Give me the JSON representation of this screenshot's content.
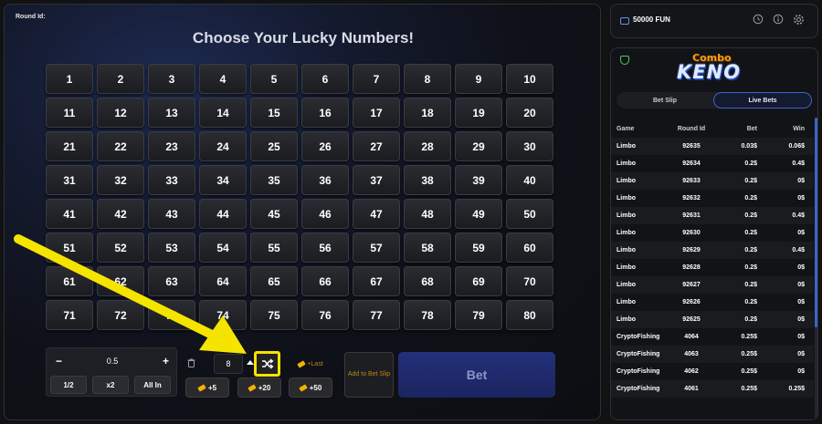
{
  "game": {
    "round_id_label": "Round Id:",
    "title": "Choose Your Lucky Numbers!",
    "numbers": [
      "1",
      "2",
      "3",
      "4",
      "5",
      "6",
      "7",
      "8",
      "9",
      "10",
      "11",
      "12",
      "13",
      "14",
      "15",
      "16",
      "17",
      "18",
      "19",
      "20",
      "21",
      "22",
      "23",
      "24",
      "25",
      "26",
      "27",
      "28",
      "29",
      "30",
      "31",
      "32",
      "33",
      "34",
      "35",
      "36",
      "37",
      "38",
      "39",
      "40",
      "41",
      "42",
      "43",
      "44",
      "45",
      "46",
      "47",
      "48",
      "49",
      "50",
      "51",
      "52",
      "53",
      "54",
      "55",
      "56",
      "57",
      "58",
      "59",
      "60",
      "61",
      "62",
      "63",
      "64",
      "65",
      "66",
      "67",
      "68",
      "69",
      "70",
      "71",
      "72",
      "73",
      "74",
      "75",
      "76",
      "77",
      "78",
      "79",
      "80"
    ]
  },
  "controls": {
    "minus": "−",
    "plus": "+",
    "stake_value": "0.5",
    "half": "1/2",
    "double": "x2",
    "all_in": "All In",
    "pick_count": "8",
    "plus_last": "+Last",
    "plus5": "+5",
    "plus20": "+20",
    "plus50": "+50",
    "add_to_slip": "Add to Bet Slip",
    "bet": "Bet"
  },
  "header": {
    "balance": "50000 FUN"
  },
  "colors": {
    "accent_blue": "#3f63c8",
    "highlight_yellow": "#f5e400",
    "gold": "#f0b400"
  },
  "bets": {
    "logo_top": "Combo",
    "logo_bottom": "KENO",
    "tab_bet_slip": "Bet Slip",
    "tab_live_bets": "Live Bets",
    "columns": {
      "game": "Game",
      "round": "Round Id",
      "bet": "Bet",
      "win": "Win"
    },
    "rows": [
      {
        "game": "Limbo",
        "round": "92635",
        "bet": "0.03$",
        "win": "0.06$"
      },
      {
        "game": "Limbo",
        "round": "92634",
        "bet": "0.2$",
        "win": "0.4$"
      },
      {
        "game": "Limbo",
        "round": "92633",
        "bet": "0.2$",
        "win": "0$"
      },
      {
        "game": "Limbo",
        "round": "92632",
        "bet": "0.2$",
        "win": "0$"
      },
      {
        "game": "Limbo",
        "round": "92631",
        "bet": "0.2$",
        "win": "0.4$"
      },
      {
        "game": "Limbo",
        "round": "92630",
        "bet": "0.2$",
        "win": "0$"
      },
      {
        "game": "Limbo",
        "round": "92629",
        "bet": "0.2$",
        "win": "0.4$"
      },
      {
        "game": "Limbo",
        "round": "92628",
        "bet": "0.2$",
        "win": "0$"
      },
      {
        "game": "Limbo",
        "round": "92627",
        "bet": "0.2$",
        "win": "0$"
      },
      {
        "game": "Limbo",
        "round": "92626",
        "bet": "0.2$",
        "win": "0$"
      },
      {
        "game": "Limbo",
        "round": "92625",
        "bet": "0.2$",
        "win": "0$"
      },
      {
        "game": "CryptoFishing",
        "round": "4064",
        "bet": "0.25$",
        "win": "0$"
      },
      {
        "game": "CryptoFishing",
        "round": "4063",
        "bet": "0.25$",
        "win": "0$"
      },
      {
        "game": "CryptoFishing",
        "round": "4062",
        "bet": "0.25$",
        "win": "0$"
      },
      {
        "game": "CryptoFishing",
        "round": "4061",
        "bet": "0.25$",
        "win": "0.25$"
      }
    ]
  }
}
